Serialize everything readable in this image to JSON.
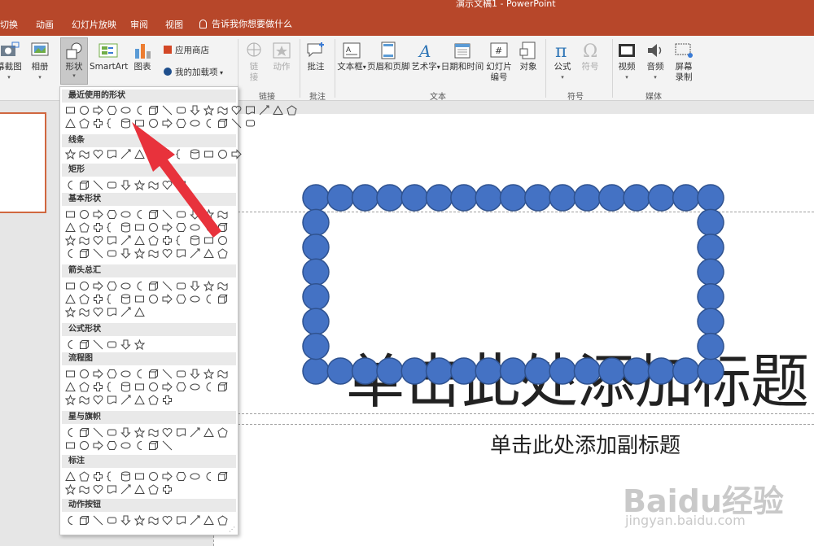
{
  "window": {
    "title": "演示文稿1 - PowerPoint"
  },
  "tabs": [
    {
      "label": "切换"
    },
    {
      "label": "动画"
    },
    {
      "label": "幻灯片放映"
    },
    {
      "label": "审阅"
    },
    {
      "label": "视图"
    }
  ],
  "tell_me": "告诉我你想要做什么",
  "ribbon": {
    "screenshot_label": "幕截图",
    "album_label": "相册",
    "shapes_label": "形状",
    "smartart_label": "SmartArt",
    "chart_label": "图表",
    "store_label": "应用商店",
    "addins_label": "我的加载项",
    "link_label": "链接",
    "action_label": "动作",
    "comment_label": "批注",
    "textbox_label": "文本框",
    "headerfooter_label": "页眉和页脚",
    "wordart_label": "艺术字",
    "datetime_label": "日期和时间",
    "slidenum_label": "幻灯片编号",
    "object_label": "对象",
    "equation_label": "公式",
    "symbol_label": "符号",
    "video_label": "视频",
    "audio_label": "音频",
    "screenrec_label": "屏幕录制",
    "groups": {
      "links": "链接",
      "comments": "批注",
      "text": "文本",
      "symbols": "符号",
      "media": "媒体"
    }
  },
  "gallery": {
    "sections": [
      {
        "title": "最近使用的形状"
      },
      {
        "title": "线条"
      },
      {
        "title": "矩形"
      },
      {
        "title": "基本形状"
      },
      {
        "title": "箭头总汇"
      },
      {
        "title": "公式形状"
      },
      {
        "title": "流程图"
      },
      {
        "title": "星与旗帜"
      },
      {
        "title": "标注"
      },
      {
        "title": "动作按钮"
      }
    ]
  },
  "slide": {
    "title_placeholder": "单击此处添加标题",
    "subtitle_placeholder": "单击此处添加副标题"
  },
  "watermark": {
    "brand": "Baidu经验",
    "url": "jingyan.baidu.com"
  },
  "colors": {
    "accent": "#b7472a",
    "bead_fill": "#4472c4",
    "bead_stroke": "#2f528f",
    "arrow": "#e8323c"
  }
}
